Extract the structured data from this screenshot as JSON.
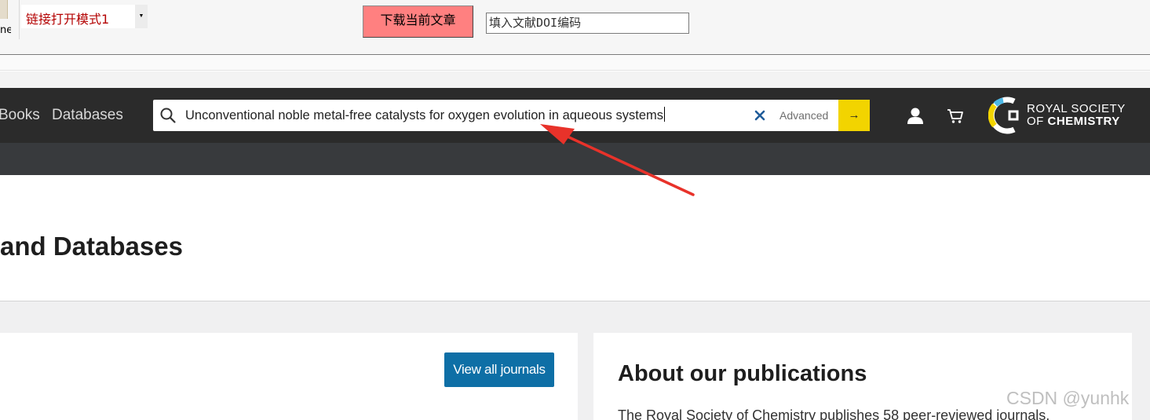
{
  "toolbar": {
    "cut_text": "ne",
    "mode_select_value": "链接打开模式1",
    "download_button": "下载当前文章",
    "doi_input_value": "填入文献DOI编码"
  },
  "header": {
    "nav": [
      "Books",
      "Databases"
    ],
    "search": {
      "value": "Unconventional noble metal-free catalysts for oxygen evolution in aqueous systems",
      "advanced_label": "Advanced",
      "go_label": "→"
    },
    "logo": {
      "line1": "ROYAL SOCIETY",
      "line2_prefix": "OF ",
      "line2_bold": "CHEMISTRY"
    },
    "accent_color": "#f2d400"
  },
  "page": {
    "title": "and Databases",
    "view_all_button": "View all journals",
    "about_title": "About our publications",
    "about_text": "The Royal Society of Chemistry publishes 58 peer-reviewed journals,"
  },
  "watermark": "CSDN @yunhk",
  "icons": [
    "search-icon",
    "clear-icon",
    "arrow-right-icon",
    "user-icon",
    "cart-icon",
    "rsc-logo-mark"
  ]
}
